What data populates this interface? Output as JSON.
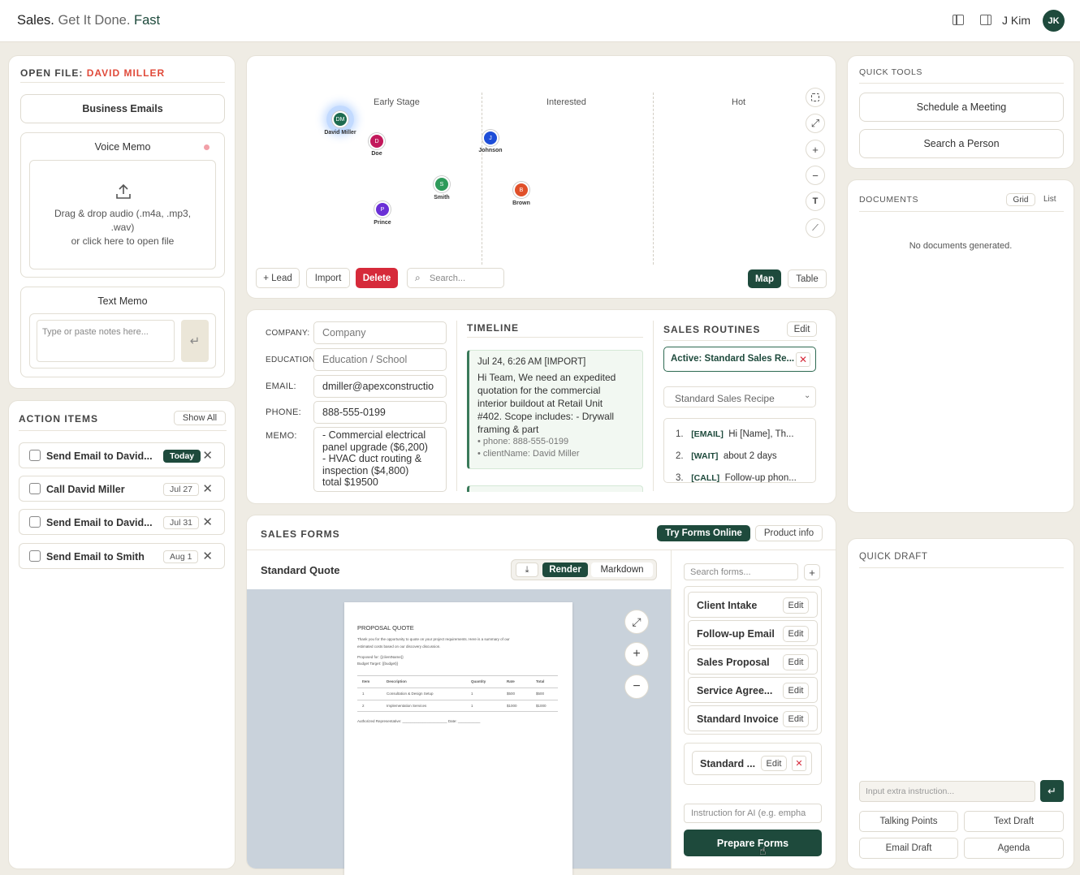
{
  "header": {
    "title_bold": "Sales.",
    "title_mid": " Get It Done.",
    "title_accent": " Fast",
    "user_name": "J Kim",
    "avatar": "JK"
  },
  "open_file": {
    "label": "OPEN FILE:",
    "name": "DAVID MILLER",
    "business_emails": "Business Emails",
    "voice_memo": "Voice Memo",
    "drop_line1": "Drag & drop audio (.m4a, .mp3,",
    "drop_line2": ".wav)",
    "drop_line3": "or click here to open file",
    "text_memo": "Text Memo",
    "text_placeholder": "Type or paste notes here..."
  },
  "action_items": {
    "title": "ACTION ITEMS",
    "show_all": "Show All",
    "items": [
      {
        "text": "Send Email to David...",
        "date": "Today"
      },
      {
        "text": "Call David Miller",
        "date": "Jul 27"
      },
      {
        "text": "Send Email to David...",
        "date": "Jul 31"
      },
      {
        "text": "Send Email to Smith",
        "date": "Aug 1"
      }
    ]
  },
  "map": {
    "stages": [
      "Early Stage",
      "Interested",
      "Hot"
    ],
    "nodes": [
      {
        "initials": "DM",
        "name": "David Miller",
        "color": "#1e6b50"
      },
      {
        "initials": "D",
        "name": "Doe",
        "color": "#c2185b"
      },
      {
        "initials": "J",
        "name": "Johnson",
        "color": "#1e4ed8"
      },
      {
        "initials": "S",
        "name": "Smith",
        "color": "#2e9a5a"
      },
      {
        "initials": "B",
        "name": "Brown",
        "color": "#e0502a"
      },
      {
        "initials": "P",
        "name": "Prince",
        "color": "#6a2fd6"
      }
    ],
    "lead": "+ Lead",
    "import": "Import",
    "delete": "Delete",
    "search_placeholder": "Search...",
    "map_btn": "Map",
    "table_btn": "Table",
    "tools": [
      "select-icon",
      "expand-icon",
      "zoom-in-icon",
      "zoom-out-icon",
      "text-tool-icon",
      "link-icon"
    ]
  },
  "contact": {
    "company_label": "COMPANY:",
    "company_placeholder": "Company",
    "education_label": "EDUCATION:",
    "education_placeholder": "Education / School",
    "email_label": "EMAIL:",
    "email_value": "dmiller@apexconstructio",
    "phone_label": "PHONE:",
    "phone_value": "888-555-0199",
    "memo_label": "MEMO:",
    "memo_line1": "- Commercial electrical",
    "memo_line2": "panel upgrade ($6,200)",
    "memo_line3": "- HVAC duct routing &",
    "memo_line4": "inspection ($4,800)",
    "memo_line5": "total $19500"
  },
  "timeline": {
    "title": "TIMELINE",
    "entry_head": "Jul 24, 6:26 AM  [IMPORT]",
    "entry_l1": "Hi Team, We need an expedited",
    "entry_l2": "quotation for the commercial",
    "entry_l3": "interior buildout at Retail Unit",
    "entry_l4": "#402. Scope includes: - Drywall",
    "entry_l5": "framing & part",
    "bullet1": "• phone: 888-555-0199",
    "bullet2": "• clientName: David Miller"
  },
  "routines": {
    "title": "SALES ROUTINES",
    "edit": "Edit",
    "active": "Active: Standard Sales Re...",
    "select": "Standard Sales Recipe",
    "steps": [
      {
        "n": "1.",
        "tag": "[EMAIL]",
        "text": "Hi [Name], Th..."
      },
      {
        "n": "2.",
        "tag": "[WAIT]",
        "text": "about 2 days"
      },
      {
        "n": "3.",
        "tag": "[CALL]",
        "text": "Follow-up phon..."
      }
    ]
  },
  "sales_forms": {
    "title": "SALES FORMS",
    "try_online": "Try Forms Online",
    "product_info": "Product info",
    "doc_title": "Standard Quote",
    "render": "Render",
    "markdown": "Markdown",
    "preview_heading": "PROPOSAL QUOTE",
    "preview_intro1": "Thank you for the opportunity to quote on your project requirements. Here is a summary of our",
    "preview_intro2": "estimated costs based on our discovery discussion.",
    "preview_for": "Proposed for: {{clientName}}",
    "preview_budget": "Budget Target: {{budget}}",
    "preview_cols": [
      "Item",
      "Description",
      "Quantity",
      "Rate",
      "Total"
    ],
    "preview_rows": [
      [
        "1",
        "Consultation & Design Setup",
        "1",
        "$500",
        "$500"
      ],
      [
        "2",
        "Implementation Services",
        "1",
        "$1000",
        "$1000"
      ]
    ],
    "preview_sign": "Authorized Representative: ______________________  Date: ___________",
    "search_placeholder": "Search forms...",
    "forms": [
      {
        "name": "Client Intake",
        "edit": "Edit"
      },
      {
        "name": "Follow-up Email",
        "edit": "Edit"
      },
      {
        "name": "Sales Proposal",
        "edit": "Edit"
      },
      {
        "name": "Service Agree...",
        "edit": "Edit"
      },
      {
        "name": "Standard Invoice",
        "edit": "Edit"
      }
    ],
    "selected": {
      "name": "Standard ...",
      "edit": "Edit"
    },
    "ai_placeholder": "Instruction for AI (e.g. empha",
    "prepare": "Prepare Forms"
  },
  "quick_tools": {
    "title": "QUICK TOOLS",
    "schedule": "Schedule a Meeting",
    "search_person": "Search a Person"
  },
  "documents": {
    "title": "DOCUMENTS",
    "grid": "Grid",
    "list": "List",
    "empty": "No documents generated."
  },
  "quick_draft": {
    "title": "QUICK DRAFT",
    "input_placeholder": "Input extra instruction...",
    "talking_points": "Talking Points",
    "text_draft": "Text Draft",
    "email_draft": "Email Draft",
    "agenda": "Agenda"
  },
  "colors": {
    "accent": "#1e4a3c",
    "danger": "#d62a3a",
    "brand_red": "#e04a3a"
  }
}
